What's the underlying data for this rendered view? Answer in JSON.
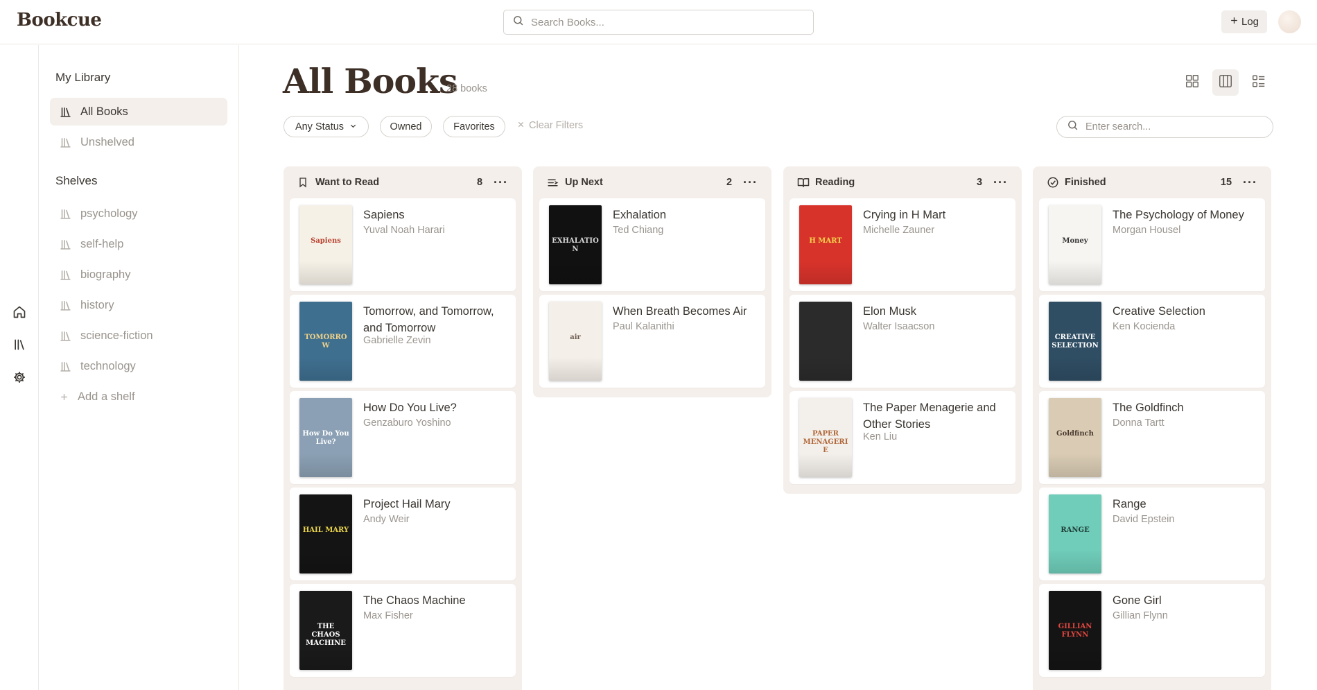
{
  "app": {
    "logo": "Bookcue"
  },
  "topbar": {
    "search_placeholder": "Search Books...",
    "log_label": "Log"
  },
  "sidebar": {
    "library_heading": "My Library",
    "library_items": [
      {
        "label": "All Books",
        "active": true
      },
      {
        "label": "Unshelved",
        "active": false
      }
    ],
    "shelves_heading": "Shelves",
    "shelves": [
      "psychology",
      "self-help",
      "biography",
      "history",
      "science-fiction",
      "technology"
    ],
    "add_shelf_label": "Add a shelf"
  },
  "main": {
    "title": "All Books",
    "count_label": "28 books",
    "filters": {
      "status": "Any Status",
      "owned": "Owned",
      "favorites": "Favorites",
      "clear": "Clear Filters"
    },
    "search_placeholder": "Enter search...",
    "view_modes": [
      "grid",
      "board",
      "list"
    ],
    "active_view": "board"
  },
  "columns": [
    {
      "title": "Want to Read",
      "count": "8",
      "icon": "bookmark-icon",
      "books": [
        {
          "title": "Sapiens",
          "author": "Yuval Noah Harari",
          "cover": {
            "bg": "#f6f1e7",
            "fg": "#b8412e",
            "text": "Sapiens"
          }
        },
        {
          "title": "Tomorrow, and Tomorrow, and Tomorrow",
          "author": "Gabrielle Zevin",
          "cover": {
            "bg": "#3f6f8f",
            "fg": "#f0d28a",
            "text": "TOMORROW"
          }
        },
        {
          "title": "How Do You Live?",
          "author": "Genzaburo Yoshino",
          "cover": {
            "bg": "#8ba0b4",
            "fg": "#ffffff",
            "text": "How Do You Live?"
          }
        },
        {
          "title": "Project Hail Mary",
          "author": "Andy Weir",
          "cover": {
            "bg": "#141414",
            "fg": "#e9d44a",
            "text": "HAIL MARY"
          }
        },
        {
          "title": "The Chaos Machine",
          "author": "Max Fisher",
          "cover": {
            "bg": "#1a1a1a",
            "fg": "#ffffff",
            "text": "THE CHAOS MACHINE"
          }
        }
      ]
    },
    {
      "title": "Up Next",
      "count": "2",
      "icon": "list-icon",
      "books": [
        {
          "title": "Exhalation",
          "author": "Ted Chiang",
          "cover": {
            "bg": "#111111",
            "fg": "#d9d9d9",
            "text": "EXHALATION"
          }
        },
        {
          "title": "When Breath Becomes Air",
          "author": "Paul Kalanithi",
          "cover": {
            "bg": "#f5efe9",
            "fg": "#6b5a4f",
            "text": "air"
          }
        }
      ]
    },
    {
      "title": "Reading",
      "count": "3",
      "icon": "open-book-icon",
      "books": [
        {
          "title": "Crying in H Mart",
          "author": "Michelle Zauner",
          "cover": {
            "bg": "#d8332b",
            "fg": "#f7d44c",
            "text": "H MART"
          }
        },
        {
          "title": "Elon Musk",
          "author": "Walter Isaacson",
          "cover": {
            "bg": "#2b2b2b",
            "fg": "#ffffff",
            "text": ""
          }
        },
        {
          "title": "The Paper Menagerie and Other Stories",
          "author": "Ken Liu",
          "cover": {
            "bg": "#f3f0eb",
            "fg": "#b1683a",
            "text": "PAPER MENAGERIE"
          }
        }
      ]
    },
    {
      "title": "Finished",
      "count": "15",
      "icon": "check-circle-icon",
      "books": [
        {
          "title": "The Psychology of Money",
          "author": "Morgan Housel",
          "cover": {
            "bg": "#f7f5f1",
            "fg": "#333333",
            "text": "Money"
          }
        },
        {
          "title": "Creative Selection",
          "author": "Ken Kocienda",
          "cover": {
            "bg": "#2f4d63",
            "fg": "#ffffff",
            "text": "CREATIVE SELECTION"
          }
        },
        {
          "title": "The Goldfinch",
          "author": "Donna Tartt",
          "cover": {
            "bg": "#d9cbb4",
            "fg": "#4a3c2f",
            "text": "Goldfinch"
          }
        },
        {
          "title": "Range",
          "author": "David Epstein",
          "cover": {
            "bg": "#6fcdb9",
            "fg": "#1f3b36",
            "text": "RANGE"
          }
        },
        {
          "title": "Gone Girl",
          "author": "Gillian Flynn",
          "cover": {
            "bg": "#141414",
            "fg": "#e0463f",
            "text": "GILLIAN FLYNN"
          }
        }
      ]
    }
  ]
}
